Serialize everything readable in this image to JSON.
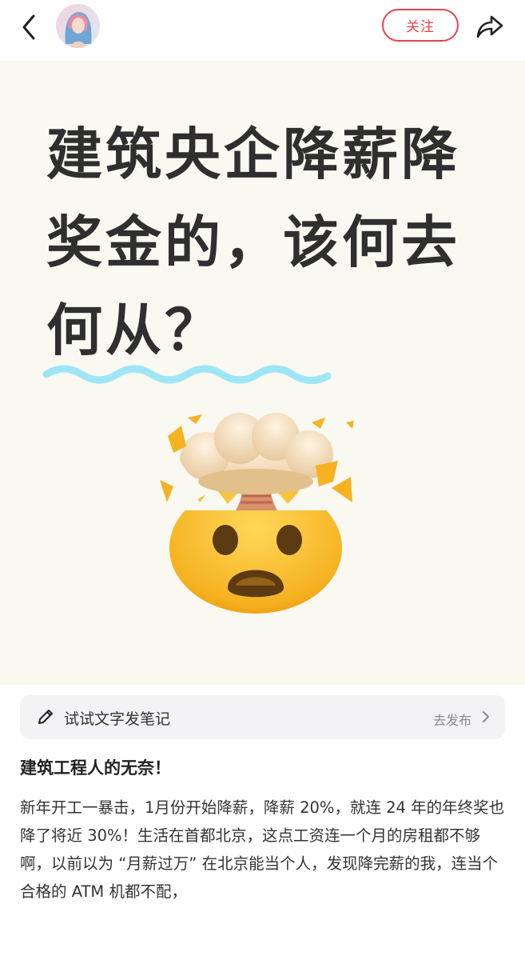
{
  "header": {
    "back_icon": "chevron-left-icon",
    "avatar_icon": "user-avatar",
    "follow_label": "关注",
    "share_icon": "share-arrow-icon",
    "accent_color": "#e8424f"
  },
  "cover": {
    "title": "建筑央企降薪降奖金的，该何去何从？",
    "underline_color": "#9ee6f5",
    "emoji": "exploding-head-emoji"
  },
  "prompt_bar": {
    "icon": "pencil-icon",
    "text": "试试文字发笔记",
    "link": "去发布"
  },
  "post": {
    "title": "建筑工程人的无奈！",
    "body": "新年开工一暴击，1月份开始降薪，降薪 20%，就连 24 年的年终奖也降了将近 30%！生活在首都北京，这点工资连一个月的房租都不够啊，以前以为 “月薪过万” 在北京能当个人，发现降完薪的我，连当个合格的 ATM 机都不配，"
  }
}
